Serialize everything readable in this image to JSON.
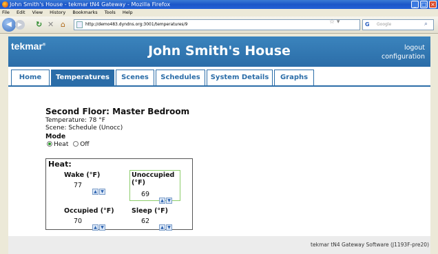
{
  "window": {
    "title": "John Smith's House - tekmar tN4 Gateway - Mozilla Firefox"
  },
  "menu": [
    "File",
    "Edit",
    "View",
    "History",
    "Bookmarks",
    "Tools",
    "Help"
  ],
  "browser": {
    "url": "http://demo483.dyndns.org:3001/temperatures/9",
    "search_placeholder": "Google"
  },
  "header": {
    "logo": "tekmar",
    "title": "John Smith's House",
    "logout": "logout",
    "configuration": "configuration"
  },
  "tabs": [
    {
      "label": "Home",
      "active": false
    },
    {
      "label": "Temperatures",
      "active": true
    },
    {
      "label": "Scenes",
      "active": false
    },
    {
      "label": "Schedules",
      "active": false
    },
    {
      "label": "System Details",
      "active": false
    },
    {
      "label": "Graphs",
      "active": false
    }
  ],
  "room": {
    "title": "Second Floor: Master Bedroom",
    "temperature": "Temperature: 78 °F",
    "scene": "Scene: Schedule (Unocc)",
    "mode_label": "Mode",
    "modes": [
      {
        "label": "Heat",
        "selected": true
      },
      {
        "label": "Off",
        "selected": false
      }
    ]
  },
  "heat": {
    "title": "Heat:",
    "wake": {
      "label": "Wake (°F)",
      "value": "77"
    },
    "unoccupied": {
      "label": "Unoccupied (°F)",
      "value": "69"
    },
    "occupied": {
      "label": "Occupied (°F)",
      "value": "70"
    },
    "sleep": {
      "label": "Sleep (°F)",
      "value": "62"
    }
  },
  "footer": "tekmar tN4 Gateway Software (J1193F-pre20)",
  "colors": {
    "header_blue": "#2b6da8",
    "unoccupied_highlight": "#8ccd6a"
  }
}
